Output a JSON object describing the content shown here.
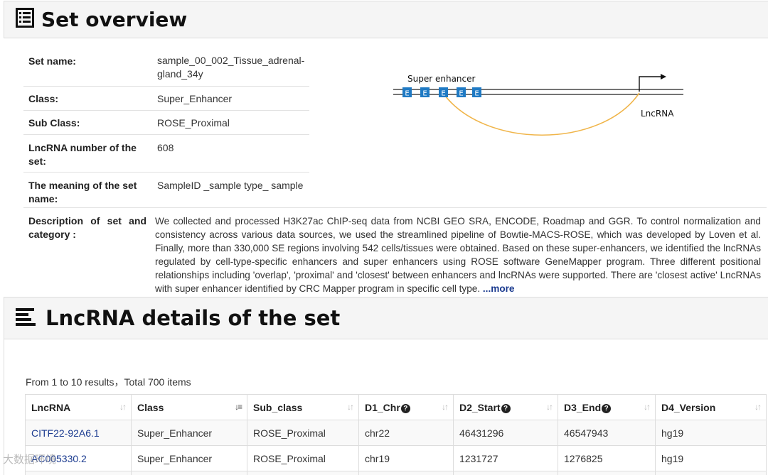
{
  "overview": {
    "title": "Set overview",
    "icon": "list-alt-icon",
    "rows": {
      "set_name": {
        "label": "Set name:",
        "value": "sample_00_002_Tissue_adrenal-gland_34y"
      },
      "class": {
        "label": "Class:",
        "value": "Super_Enhancer"
      },
      "sub_class": {
        "label": "Sub Class:",
        "value": "ROSE_Proximal"
      },
      "lncrna_number": {
        "label": "LncRNA number of the set:",
        "value": "608"
      },
      "meaning": {
        "label": "The meaning of the set name:",
        "value": "SampleID _sample type_ sample"
      },
      "description": {
        "label": "Description of set and category :",
        "value": "We collected and processed H3K27ac ChIP-seq data from NCBI GEO SRA, ENCODE, Roadmap and GGR. To control normalization and consistency across various data sources, we used the streamlined pipeline of Bowtie-MACS-ROSE, which was developed by Loven et al. Finally, more than 330,000 SE regions involving 542 cells/tissues were obtained. Based on these super-enhancers, we identified the lncRNAs regulated by cell-type-specific enhancers and super enhancers using ROSE software GeneMapper program. Three different positional relationships including 'overlap', 'proximal' and 'closest' between enhancers and lncRNAs were supported. There are 'closest active' LncRNAs with super enhancer identified by CRC Mapper program in specific cell type. ",
        "more": "...more"
      }
    },
    "diagram": {
      "super_enhancer_label": "Super enhancer",
      "lncrna_label": "LncRNA",
      "enhancer_letter": "E",
      "enhancer_color": "#1f7ac4",
      "arc_color": "#f0b54a"
    }
  },
  "details": {
    "title": "LncRNA details of the set",
    "icon": "align-left-icon",
    "results_text": "From 1 to 10 results，Total 700 items",
    "columns": [
      "LncRNA",
      "Class",
      "Sub_class",
      "D1_Chr",
      "D2_Start",
      "D3_End",
      "D4_Version"
    ],
    "rows": [
      [
        "CITF22-92A6.1",
        "Super_Enhancer",
        "ROSE_Proximal",
        "chr22",
        "46431296",
        "46547943",
        "hg19"
      ],
      [
        "AC005330.2",
        "Super_Enhancer",
        "ROSE_Proximal",
        "chr19",
        "1231727",
        "1276825",
        "hg19"
      ]
    ]
  },
  "watermark": "大数据环境"
}
